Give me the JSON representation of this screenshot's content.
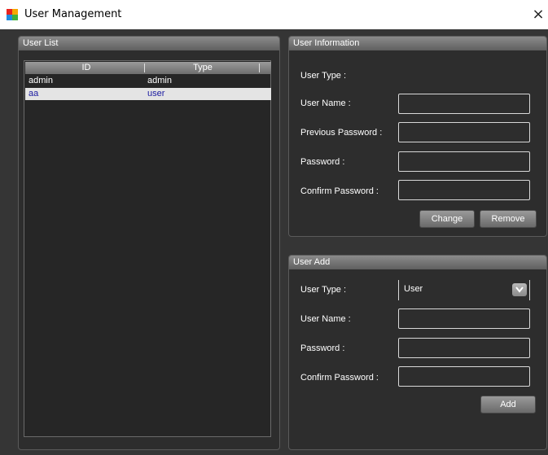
{
  "window": {
    "title": "User Management",
    "close_glyph": "×",
    "icon_colors": [
      "#e8231f",
      "#f6a800",
      "#1f8be0",
      "#3fb13a"
    ]
  },
  "user_list": {
    "title": "User List",
    "columns": [
      "ID",
      "Type"
    ],
    "rows": [
      {
        "id": "admin",
        "type": "admin",
        "selected": false
      },
      {
        "id": "aa",
        "type": "user",
        "selected": true
      }
    ]
  },
  "user_information": {
    "title": "User Information",
    "user_type_label": "User Type :",
    "user_type_value": "",
    "user_name_label": "User Name :",
    "user_name_value": "",
    "previous_password_label": "Previous Password :",
    "previous_password_value": "",
    "password_label": "Password :",
    "password_value": "",
    "confirm_password_label": "Confirm Password :",
    "confirm_password_value": "",
    "change_label": "Change",
    "remove_label": "Remove"
  },
  "user_add": {
    "title": "User Add",
    "user_type_label": "User Type :",
    "user_type_value": "User",
    "user_name_label": "User Name :",
    "user_name_value": "",
    "password_label": "Password :",
    "password_value": "",
    "confirm_password_label": "Confirm Password :",
    "confirm_password_value": "",
    "add_label": "Add"
  },
  "icons": {
    "dropdown_arrow": "chevron-down-icon",
    "app": "app-logo-icon"
  }
}
